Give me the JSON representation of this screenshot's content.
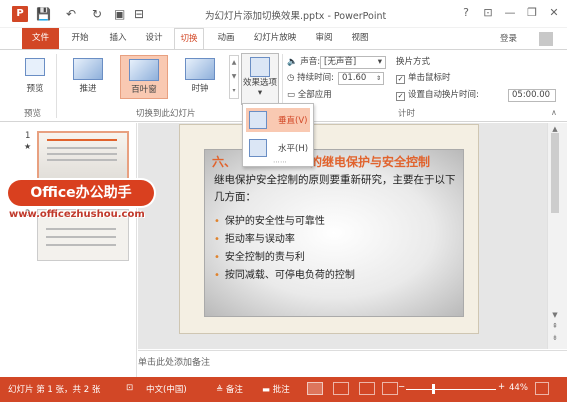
{
  "titlebar": {
    "app_icon": "P",
    "doc_title": "为幻灯片添加切换效果.pptx - PowerPoint",
    "qa_icons": [
      "save-icon",
      "undo-icon",
      "redo-icon",
      "touch-mode-icon",
      "customize-icon"
    ],
    "qa_glyphs": [
      "💾",
      "↶",
      "↻",
      "▣",
      "⊟"
    ],
    "window_glyphs": [
      "?",
      "⊡",
      "—",
      "❐",
      "✕"
    ],
    "login": "登录"
  },
  "tabs": [
    "文件",
    "开始",
    "插入",
    "设计",
    "切换",
    "动画",
    "幻灯片放映",
    "审阅",
    "视图"
  ],
  "ribbon": {
    "preview": {
      "label": "预览",
      "group": "预览"
    },
    "effects": [
      {
        "label": "推进"
      },
      {
        "label": "百叶窗"
      },
      {
        "label": "时钟"
      }
    ],
    "effects_group": "切换到此幻灯片",
    "effect_options": "效果选项",
    "timing": {
      "sound_label": "声音:",
      "sound_value": "[无声音]",
      "duration_label": "持续时间:",
      "duration_value": "01.60",
      "apply_all": "全部应用",
      "advance_title": "换片方式",
      "on_click": "单击鼠标时",
      "after_label": "设置自动换片时间:",
      "after_value": "05:00.00",
      "group": "计时"
    }
  },
  "dropdown": {
    "vertical": "垂直(V)",
    "horizontal": "水平(H)",
    "more": "⋯⋯"
  },
  "thumbnails": {
    "slide1_number": "1",
    "slide1_star": "★",
    "slide2_number": "2"
  },
  "slide": {
    "title_lead": "六、",
    "title_tail": "的继电保护与安全控制",
    "intro": "继电保护安全控制的原则要重新研究，主要在于以下几方面：",
    "bullets": [
      "保护的安全性与可靠性",
      "拒动率与误动率",
      "安全控制的责与利",
      "按同减载、可停电负荷的控制"
    ]
  },
  "notes_placeholder": "单击此处添加备注",
  "status": {
    "slide_info": "幻灯片 第 1 张，共 2 张",
    "language": "中文(中国)",
    "notes": "备注",
    "comments": "批注",
    "zoom": "44%",
    "zoom_level": 0.44
  },
  "watermark": {
    "logo": "Office办公助手",
    "url": "www.officezhushou.com"
  },
  "colors": {
    "accent": "#d24726",
    "selected": "#f9c9b2",
    "title_orange": "#e1632d"
  }
}
